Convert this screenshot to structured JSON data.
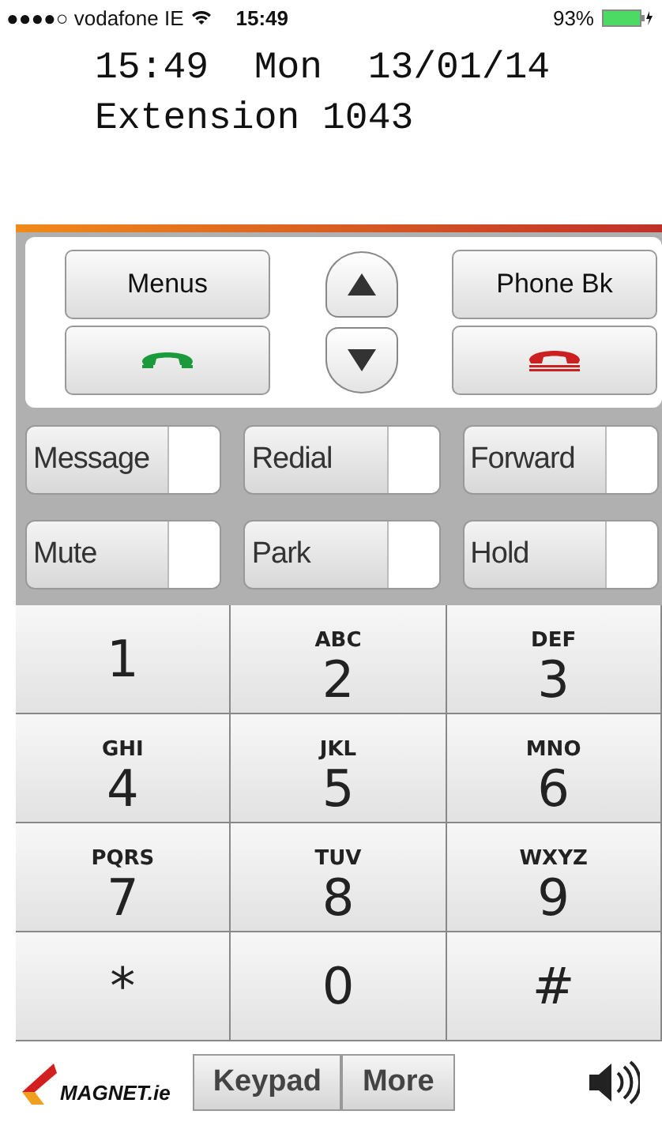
{
  "status_bar": {
    "carrier": "●●●●○ vodafone IE",
    "time": "15:49",
    "battery": "93%"
  },
  "header": {
    "line_1": "15:49  Mon  13/01/14",
    "line_2": "Extension 1043"
  },
  "top_buttons": {
    "left": "Menus",
    "right": "Phone Bk"
  },
  "toggles": [
    {
      "label": "Message",
      "on": false
    },
    {
      "label": "Redial",
      "on": false
    },
    {
      "label": "Forward",
      "on": false
    },
    {
      "label": "Mute",
      "on": false
    },
    {
      "label": "Park",
      "on": false
    },
    {
      "label": "Hold",
      "on": false
    }
  ],
  "keys": [
    {
      "digit": "1"
    },
    {
      "digit": "2",
      "letters": "ABC"
    },
    {
      "digit": "3",
      "letters": "DEF"
    },
    {
      "digit": "4",
      "letters": "GHI"
    },
    {
      "digit": "5",
      "letters": "JKL"
    },
    {
      "digit": "6",
      "letters": "MNO"
    },
    {
      "digit": "7",
      "letters": "PQRS"
    },
    {
      "digit": "8",
      "letters": "TUV"
    },
    {
      "digit": "9",
      "letters": "WXYZ"
    },
    {
      "digit": "*"
    },
    {
      "digit": "0"
    },
    {
      "digit": "#"
    }
  ],
  "footer": {
    "logo": "MAGNET.ie",
    "tabs": [
      "Keypad",
      "More"
    ]
  }
}
